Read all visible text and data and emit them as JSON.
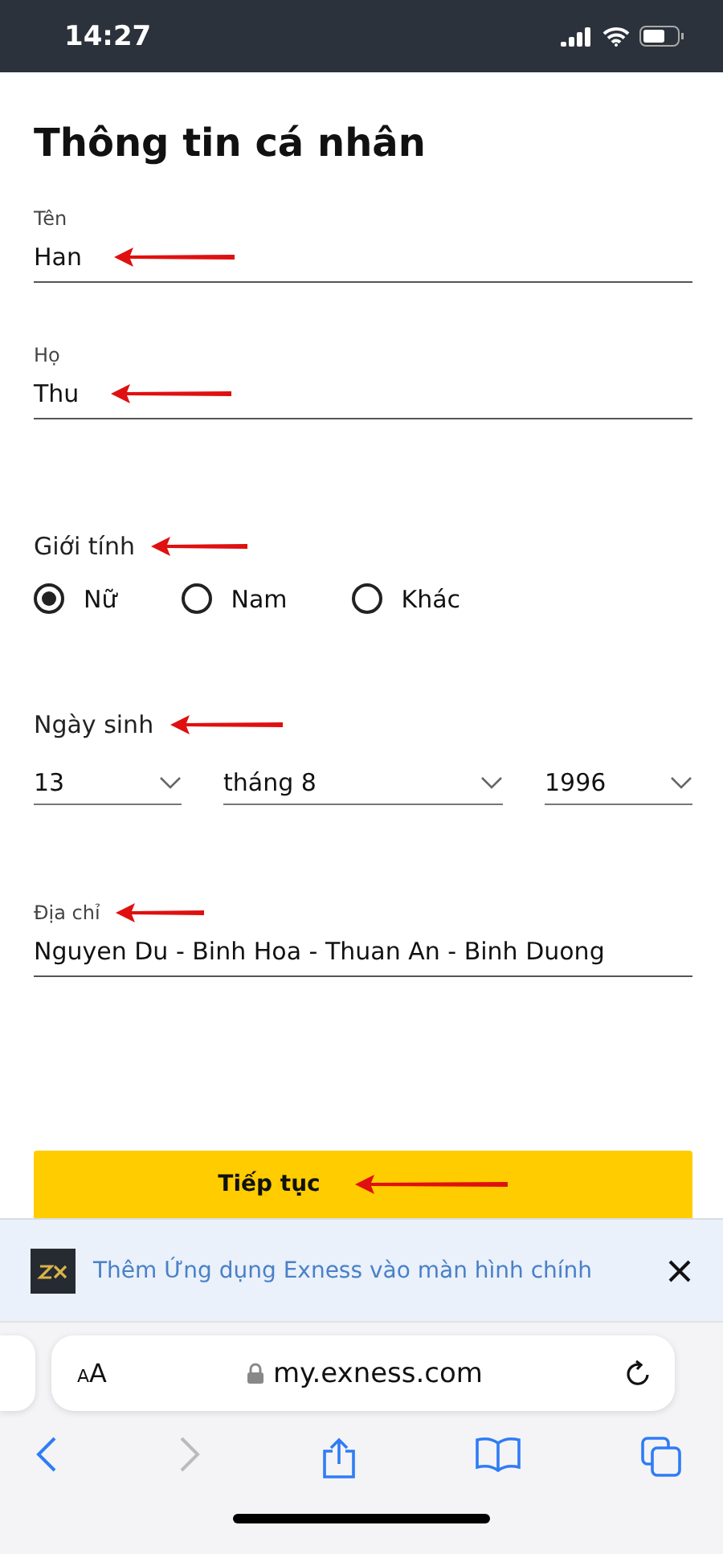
{
  "status_bar": {
    "time": "14:27"
  },
  "form": {
    "title": "Thông tin cá nhân",
    "first_name": {
      "label": "Tên",
      "value": "Han"
    },
    "last_name": {
      "label": "Họ",
      "value": "Thu"
    },
    "gender": {
      "label": "Giới tính",
      "options": [
        {
          "label": "Nữ",
          "selected": true
        },
        {
          "label": "Nam",
          "selected": false
        },
        {
          "label": "Khác",
          "selected": false
        }
      ]
    },
    "birth_date": {
      "label": "Ngày sinh",
      "selects": [
        {
          "value": "13"
        },
        {
          "value": "tháng 8"
        },
        {
          "value": "1996"
        }
      ]
    },
    "address": {
      "label": "Địa chỉ",
      "value": "Nguyen Du - Binh Hoa - Thuan An - Binh Duong"
    },
    "submit": "Tiếp tục"
  },
  "install_banner": {
    "text": "Thêm Ứng dụng Exness vào màn hình chính"
  },
  "browser": {
    "text_size": "AA",
    "url": "my.exness.com"
  }
}
